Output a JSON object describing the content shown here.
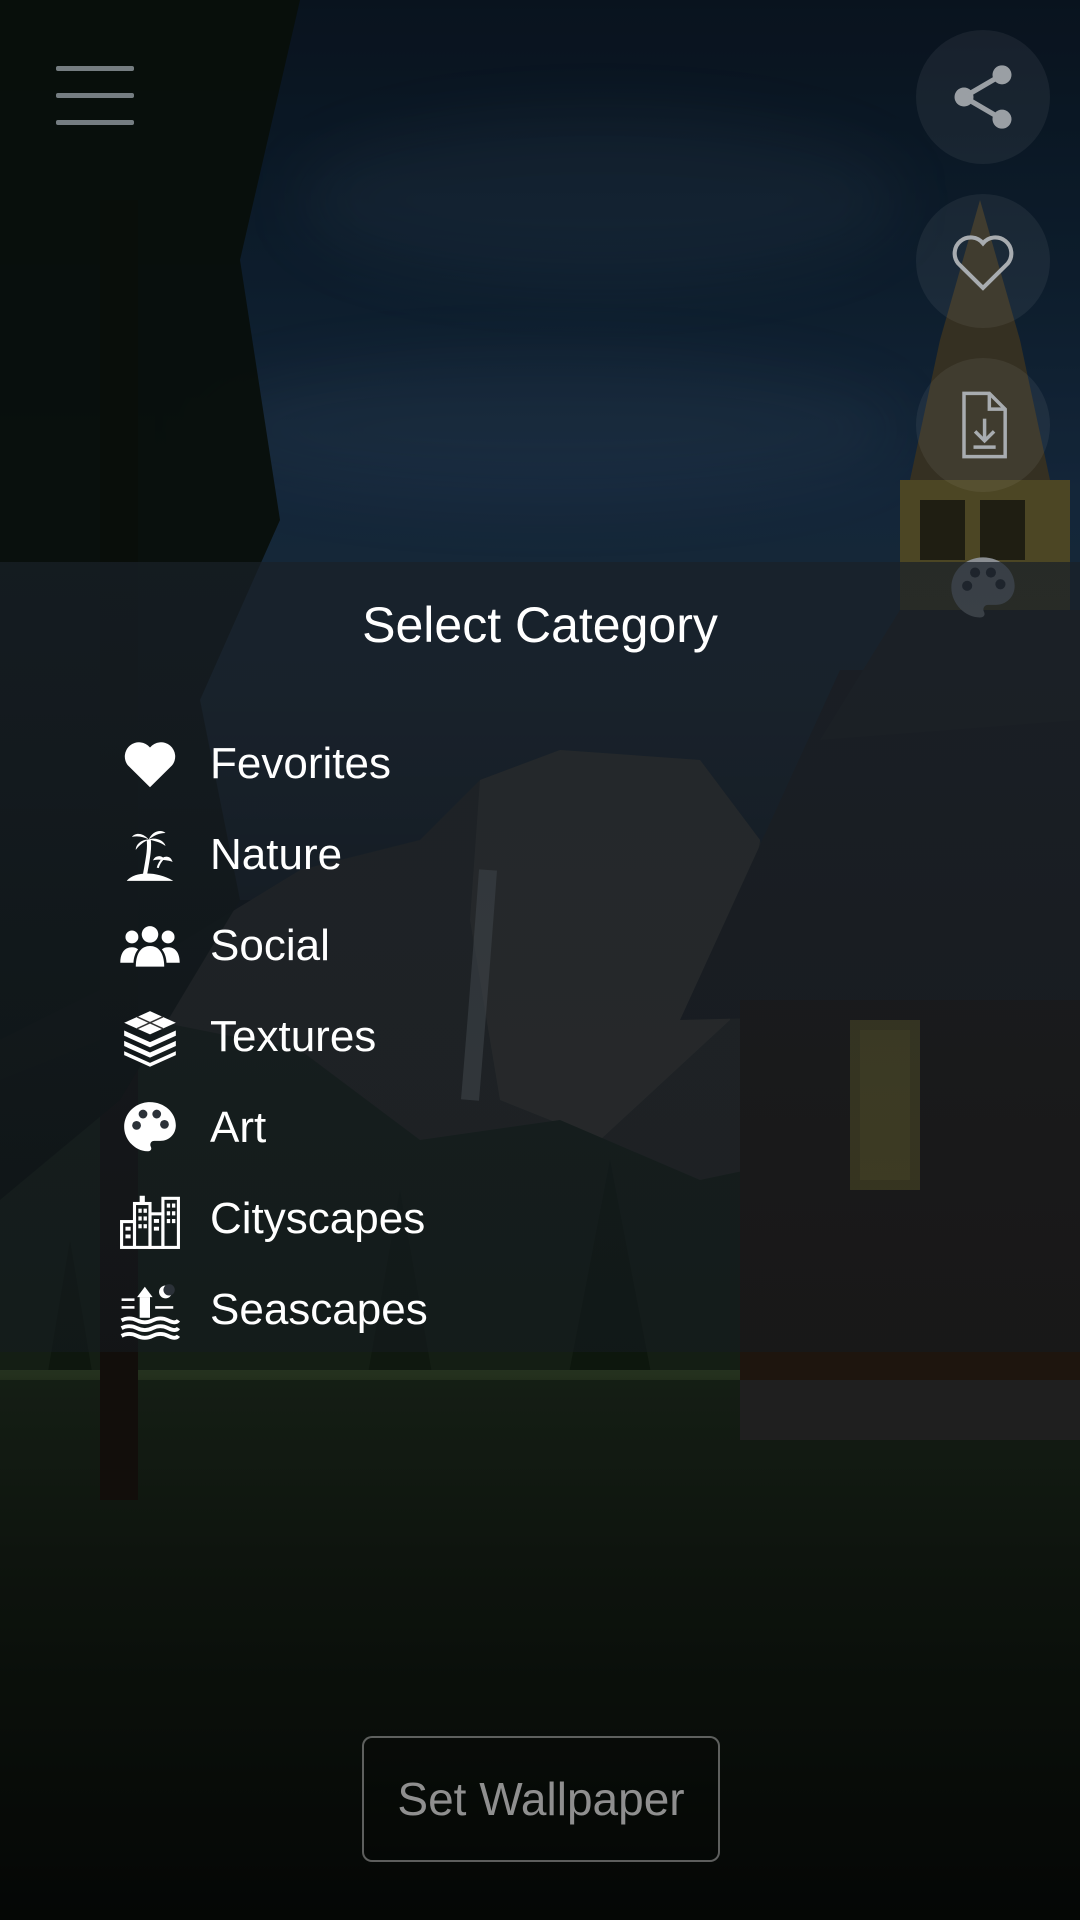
{
  "toolbar": {
    "menu_icon": "hamburger-menu-icon",
    "share_icon": "share-icon",
    "favorite_icon": "heart-outline-icon",
    "download_icon": "download-file-icon",
    "palette_icon": "palette-icon"
  },
  "category_panel": {
    "title": "Select Category",
    "items": [
      {
        "label": "Fevorites",
        "icon": "heart-icon"
      },
      {
        "label": "Nature",
        "icon": "palm-island-icon"
      },
      {
        "label": "Social",
        "icon": "people-group-icon"
      },
      {
        "label": "Textures",
        "icon": "layers-texture-icon"
      },
      {
        "label": "Art",
        "icon": "palette-icon"
      },
      {
        "label": "Cityscapes",
        "icon": "city-buildings-icon"
      },
      {
        "label": "Seascapes",
        "icon": "lighthouse-sea-icon"
      }
    ]
  },
  "footer": {
    "set_wallpaper_label": "Set Wallpaper"
  },
  "colors": {
    "text": "#ffffff",
    "button_text": "#8f8f8f",
    "panel_overlay": "#19202880"
  }
}
